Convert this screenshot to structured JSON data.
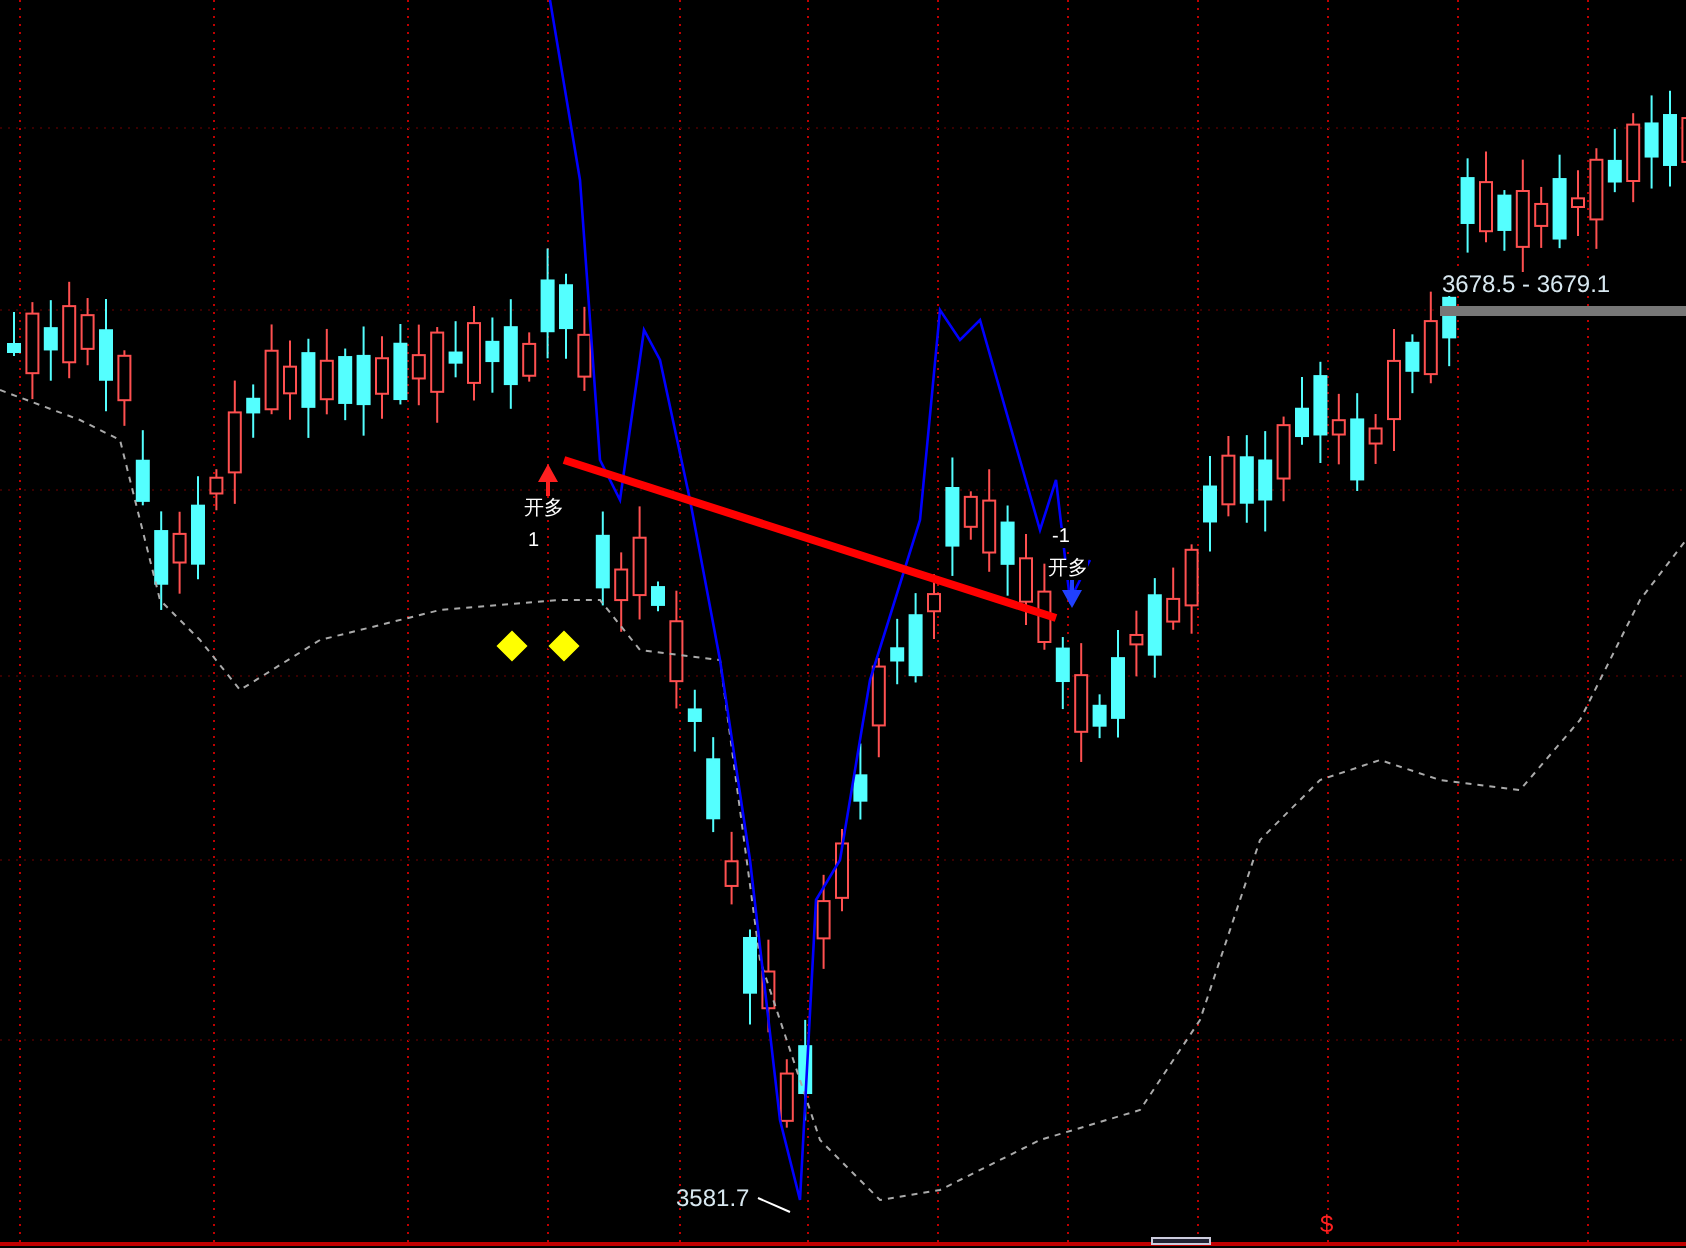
{
  "chart": {
    "markers": [
      {
        "kind": "long",
        "label": "开多",
        "count": "1"
      },
      {
        "kind": "short",
        "label": "开多",
        "count": "-1"
      }
    ],
    "range_label": "3678.5 - 3679.1",
    "low_label": "3581.7",
    "signal": "$"
  }
}
